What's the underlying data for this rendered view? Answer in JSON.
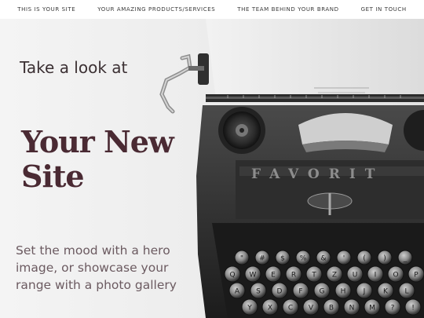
{
  "nav": {
    "items": [
      {
        "label": "THIS IS YOUR SITE"
      },
      {
        "label": "YOUR AMAZING PRODUCTS/SERVICES"
      },
      {
        "label": "THE TEAM BEHIND YOUR BRAND"
      },
      {
        "label": "GET IN TOUCH"
      }
    ]
  },
  "hero": {
    "tagline": "Take a look at",
    "headline": "Your New Site",
    "body": "Set the mood with a hero image, or showcase your range with a photo gallery",
    "image": {
      "subject": "vintage typewriter",
      "brand_text": "FAVORIT",
      "keys_row_1": [
        "\"",
        "#",
        "$",
        "%",
        "&",
        "'",
        "(",
        ")",
        "_"
      ],
      "keys_row_2": [
        "Q",
        "W",
        "E",
        "R",
        "T",
        "Z",
        "U",
        "I",
        "O",
        "P"
      ],
      "keys_row_3": [
        "A",
        "S",
        "D",
        "F",
        "G",
        "H",
        "J",
        "K",
        "L"
      ],
      "keys_row_4": [
        "Y",
        "X",
        "C",
        "V",
        "B",
        "N",
        "M",
        "?",
        "!"
      ]
    }
  },
  "colors": {
    "headline": "#4a2a33",
    "body": "#6b5a60",
    "nav_text": "#3a3a3a"
  }
}
